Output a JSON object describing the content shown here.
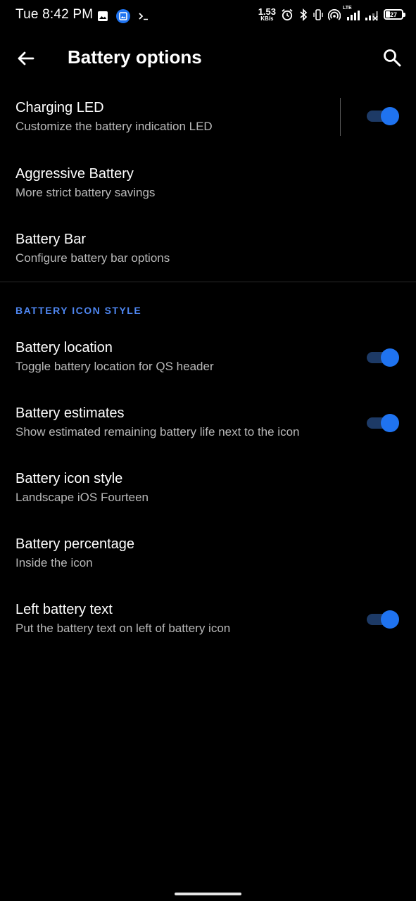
{
  "status_bar": {
    "time": "Tue 8:42 PM",
    "net_speed_value": "1.53",
    "net_speed_unit": "KB/s",
    "network_type": "LTE",
    "battery_level": "27",
    "left_icons": [
      "image-icon",
      "gallery-app-icon",
      "terminal-icon"
    ],
    "right_icons": [
      "alarm-icon",
      "bluetooth-icon",
      "vibrate-icon",
      "hotspot-icon",
      "signal-icon",
      "signal-2-icon",
      "battery-icon"
    ]
  },
  "app_bar": {
    "title": "Battery options",
    "back_icon": "arrow-back-icon",
    "search_icon": "search-icon"
  },
  "items": [
    {
      "title": "Charging LED",
      "subtitle": "Customize the battery indication LED",
      "toggle": true,
      "checked": true
    },
    {
      "title": "Aggressive Battery",
      "subtitle": "More strict battery savings",
      "toggle": false
    },
    {
      "title": "Battery Bar",
      "subtitle": "Configure battery bar options",
      "toggle": false
    }
  ],
  "section_header": "BATTERY ICON STYLE",
  "icon_style_items": [
    {
      "title": "Battery location",
      "subtitle": "Toggle battery location for QS header",
      "toggle": true,
      "checked": true
    },
    {
      "title": "Battery estimates",
      "subtitle": "Show estimated remaining battery life next to the icon",
      "toggle": true,
      "checked": true
    },
    {
      "title": "Battery icon style",
      "subtitle": "Landscape iOS Fourteen",
      "toggle": false
    },
    {
      "title": "Battery percentage",
      "subtitle": "Inside the icon",
      "toggle": false
    },
    {
      "title": "Left battery text",
      "subtitle": "Put the battery text on left of battery icon",
      "toggle": true,
      "checked": true
    }
  ],
  "colors": {
    "background": "#000000",
    "accent": "#1f73f0",
    "section_header": "#4e86f0",
    "subtitle": "#b9b9b9"
  }
}
